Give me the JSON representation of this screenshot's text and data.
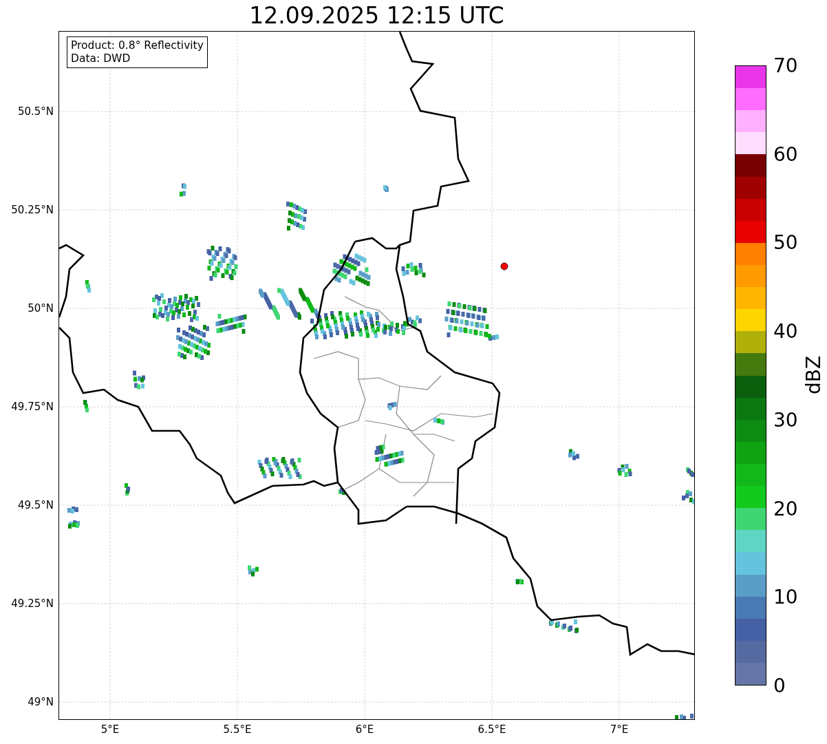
{
  "title": "12.09.2025 12:15 UTC",
  "annotation": [
    "Product: 0.8° Reflectivity",
    "Data: DWD"
  ],
  "y_ticks": [
    "50.5°N",
    "50.25°N",
    "50°N",
    "49.75°N",
    "49.5°N",
    "49.25°N",
    "49°N"
  ],
  "x_ticks": [
    "5°E",
    "5.5°E",
    "6°E",
    "6.5°E",
    "7°E"
  ],
  "colorbar": {
    "label": "dBZ",
    "ticks": [
      "70",
      "60",
      "50",
      "40",
      "30",
      "20",
      "10",
      "0"
    ],
    "segments": [
      {
        "color": "#e836e8"
      },
      {
        "color": "#ff6cff"
      },
      {
        "color": "#ffb0ff"
      },
      {
        "color": "#ffddff"
      },
      {
        "color": "#780000"
      },
      {
        "color": "#a00000"
      },
      {
        "color": "#c80000"
      },
      {
        "color": "#e60000"
      },
      {
        "color": "#ff7f00"
      },
      {
        "color": "#ff9a00"
      },
      {
        "color": "#ffb400"
      },
      {
        "color": "#ffd500"
      },
      {
        "color": "#b0b00b"
      },
      {
        "color": "#457a0f"
      },
      {
        "color": "#0a5e0c"
      },
      {
        "color": "#0a7710"
      },
      {
        "color": "#0e8c12"
      },
      {
        "color": "#0fa314"
      },
      {
        "color": "#12b81a"
      },
      {
        "color": "#12c91e"
      },
      {
        "color": "#3ed672"
      },
      {
        "color": "#5fd6c4"
      },
      {
        "color": "#66c3dd"
      },
      {
        "color": "#5a9ec8"
      },
      {
        "color": "#4a7ab4"
      },
      {
        "color": "#4660a6"
      },
      {
        "color": "#556aa0"
      },
      {
        "color": "#6675a8"
      }
    ]
  }
}
